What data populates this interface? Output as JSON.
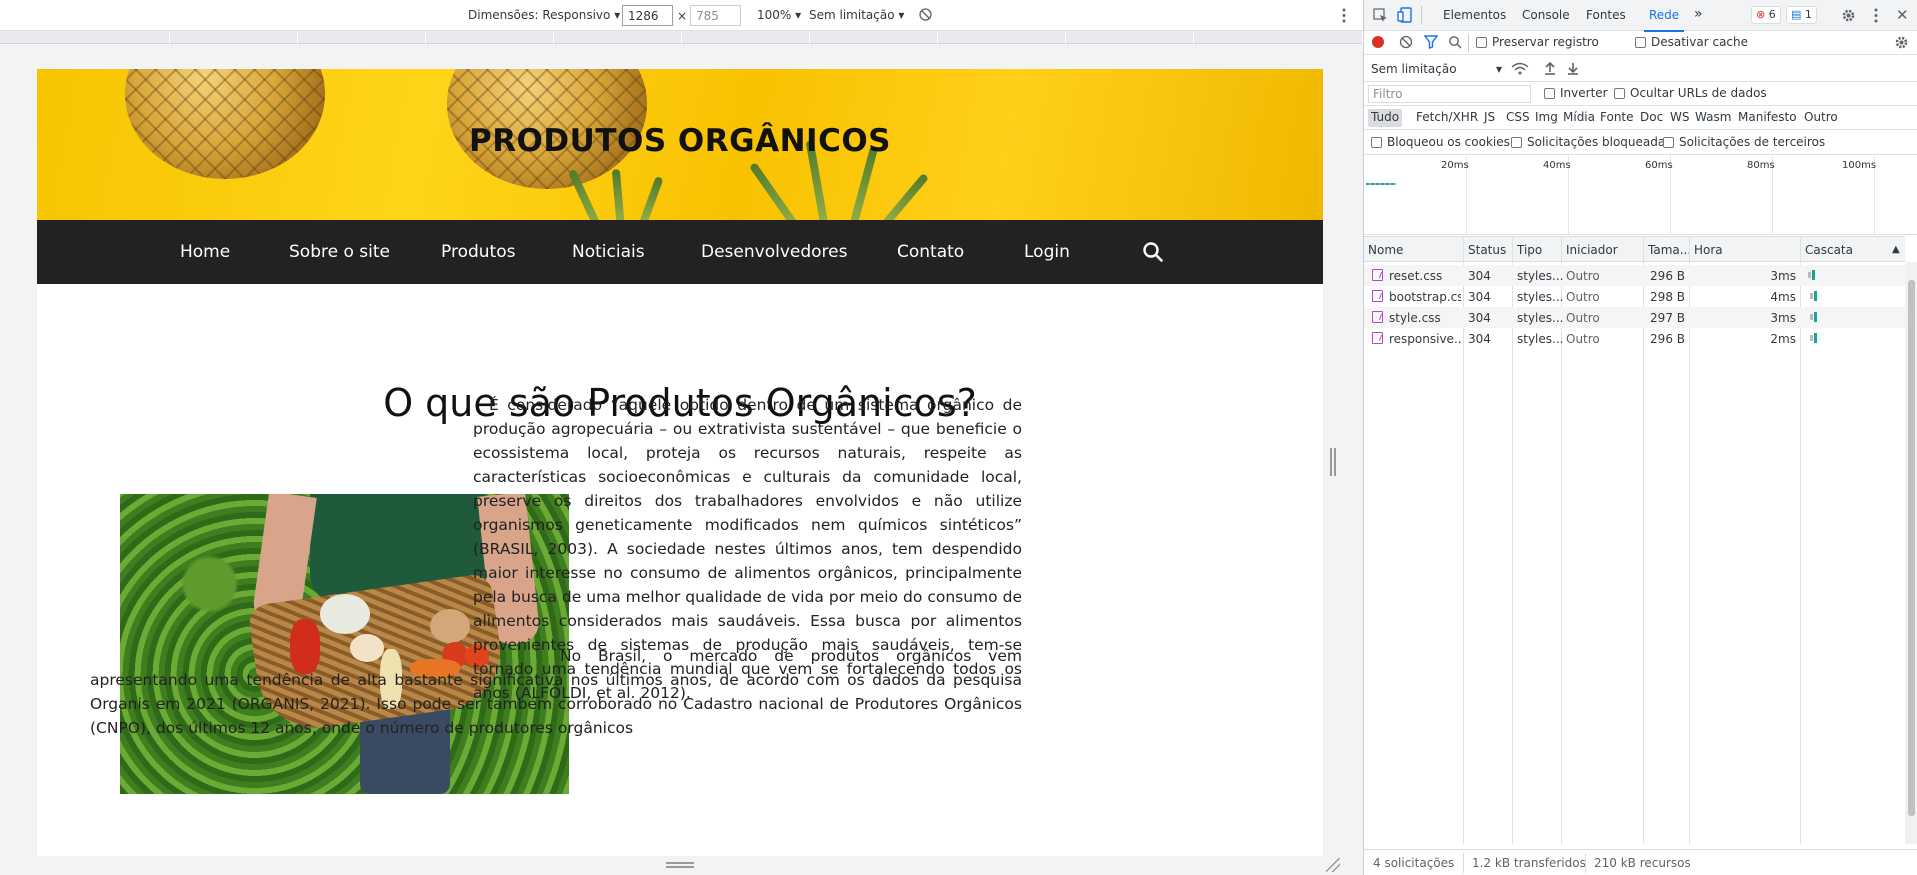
{
  "device_toolbar": {
    "dimensions_label": "Dimensões: Responsivo",
    "width_value": "1286",
    "height_placeholder": "785",
    "times": "×",
    "zoom_label": "100%",
    "throttle_label": "Sem limitação"
  },
  "site": {
    "banner_title": "PRODUTOS ORGÂNICOS",
    "nav": [
      "Home",
      "Sobre o site",
      "Produtos",
      "Noticiais",
      "Desenvolvedores",
      "Contato",
      "Login"
    ],
    "heading": "O que são Produtos Orgânicos?",
    "paragraph1": "É considerado “aquele obtido dentro de um sistema orgânico de produção agropecuária – ou extrativista sustentável – que beneficie o ecossistema local, proteja os recursos naturais, respeite as características socioeconômicas e culturais da comunidade local, preserve os direitos dos trabalhadores envolvidos e não utilize organismos geneticamente modificados nem químicos sintéticos” (BRASIL, 2003). A sociedade nestes últimos anos, tem despendido maior interesse no consumo de alimentos orgânicos, principalmente pela busca de uma melhor qualidade de vida por meio do consumo de alimentos considerados mais saudáveis. Essa busca por alimentos provenientes de sistemas de produção mais saudáveis, tem-se tornado uma tendência mundial que vem se fortalecendo todos os anos (ALFÖLDI, et al. 2012).",
    "paragraph2": "No Brasil, o mercado de produtos orgânicos vem apresentando uma tendência de alta bastante significativa nos últimos anos, de acordo com os dados da pesquisa Organis em 2021 (ORGANIS, 2021). Isso pode ser também corroborado no Cadastro nacional de Produtores Orgânicos (CNPO), dos últimos 12 anos, onde o número de produtores orgânicos"
  },
  "devtools": {
    "tabs": [
      "Elementos",
      "Console",
      "Fontes",
      "Rede"
    ],
    "active_tab": "Rede",
    "more_tabs": "»",
    "error_count": "6",
    "message_count": "1",
    "preserve_log": "Preservar registro",
    "disable_cache": "Desativar cache",
    "throttle": "Sem limitação",
    "filter_placeholder": "Filtro",
    "invert": "Inverter",
    "hide_data_urls": "Ocultar URLs de dados",
    "types": [
      "Tudo",
      "Fetch/XHR",
      "JS",
      "CSS",
      "Img",
      "Mídia",
      "Fonte",
      "Doc",
      "WS",
      "Wasm",
      "Manifesto",
      "Outro"
    ],
    "blocked_cookies": "Bloqueou os cookies",
    "blocked_requests": "Solicitações bloqueadas",
    "third_party": "Solicitações de terceiros",
    "timeline_labels": [
      "20ms",
      "40ms",
      "60ms",
      "80ms",
      "100ms"
    ],
    "columns": [
      "Nome",
      "Status",
      "Tipo",
      "Iniciador",
      "Tama...",
      "Hora",
      "Cascata"
    ],
    "rows": [
      {
        "name": "reset.css",
        "status": "304",
        "type": "styles...",
        "initiator": "Outro",
        "size": "296 B",
        "time": "3ms"
      },
      {
        "name": "bootstrap.css",
        "status": "304",
        "type": "styles...",
        "initiator": "Outro",
        "size": "298 B",
        "time": "4ms"
      },
      {
        "name": "style.css",
        "status": "304",
        "type": "styles...",
        "initiator": "Outro",
        "size": "297 B",
        "time": "3ms"
      },
      {
        "name": "responsive....",
        "status": "304",
        "type": "styles...",
        "initiator": "Outro",
        "size": "296 B",
        "time": "2ms"
      }
    ],
    "status_requests": "4 solicitações",
    "status_transferred": "1.2 kB transferidos",
    "status_resources": "210 kB recursos"
  },
  "colors": {
    "accent": "#1a73e8",
    "nav_bg": "#222222",
    "banner": "#f8c400",
    "record_red": "#d93025"
  }
}
